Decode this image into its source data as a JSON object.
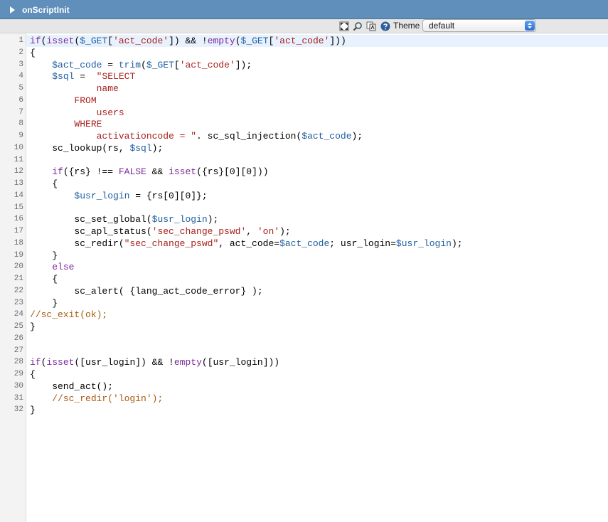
{
  "panel": {
    "title": "onScriptInit"
  },
  "toolbar": {
    "icons": [
      "fullscreen-icon",
      "search-icon",
      "replace-icon",
      "help-icon"
    ],
    "theme_label": "Theme",
    "theme_value": "default"
  },
  "colors": {
    "header": "#5f8fba",
    "keyword": "#7a2a9a",
    "variable": "#1f5fa0",
    "string": "#a8221c",
    "comment": "#a85a10"
  },
  "code": {
    "active_line": 1,
    "lines": [
      "if(isset($_GET['act_code']) && !empty($_GET['act_code']))",
      "{",
      "    $act_code = trim($_GET['act_code']);",
      "    $sql =  \"SELECT",
      "            name",
      "        FROM",
      "            users",
      "        WHERE",
      "            activationcode = \". sc_sql_injection($act_code);",
      "    sc_lookup(rs, $sql);",
      "",
      "    if({rs} !== FALSE && isset({rs}[0][0]))",
      "    {",
      "        $usr_login = {rs[0][0]};",
      "",
      "        sc_set_global($usr_login);",
      "        sc_apl_status('sec_change_pswd', 'on');",
      "        sc_redir(\"sec_change_pswd\", act_code=$act_code; usr_login=$usr_login);",
      "    }",
      "    else",
      "    {",
      "        sc_alert( {lang_act_code_error} );",
      "    }",
      "//sc_exit(ok);",
      "}",
      "",
      "",
      "if(isset([usr_login]) && !empty([usr_login]))",
      "{",
      "    send_act();",
      "    //sc_redir('login');",
      "}"
    ]
  }
}
